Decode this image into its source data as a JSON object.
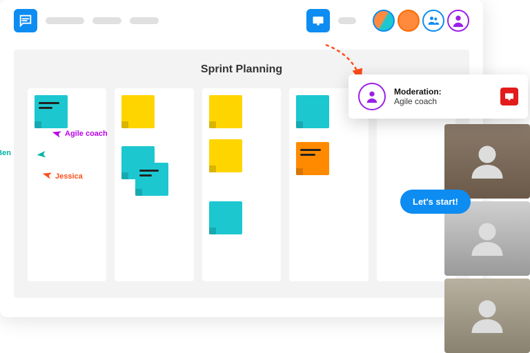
{
  "board": {
    "title": "Sprint Planning"
  },
  "tooltip": {
    "title": "Moderation:",
    "subtitle": "Agile coach"
  },
  "cursors": {
    "agile": "Agile coach",
    "ben": "Ben",
    "jessica": "Jessica"
  },
  "cta": {
    "label": "Let's start!"
  },
  "columns": [
    {
      "stickies": [
        {
          "color": "teal",
          "lined": true
        }
      ]
    },
    {
      "stickies": [
        {
          "color": "yellow"
        },
        {
          "color": "teal",
          "offset": 30
        },
        {
          "color": "teal",
          "lined": true,
          "overlap": true
        }
      ]
    },
    {
      "stickies": [
        {
          "color": "yellow"
        },
        {
          "color": "yellow",
          "offset": 28
        },
        {
          "color": "teal",
          "offset": 70
        }
      ]
    },
    {
      "stickies": [
        {
          "color": "teal"
        },
        {
          "color": "orange",
          "lined": true,
          "offset": 34
        }
      ]
    },
    {
      "stickies": []
    }
  ]
}
